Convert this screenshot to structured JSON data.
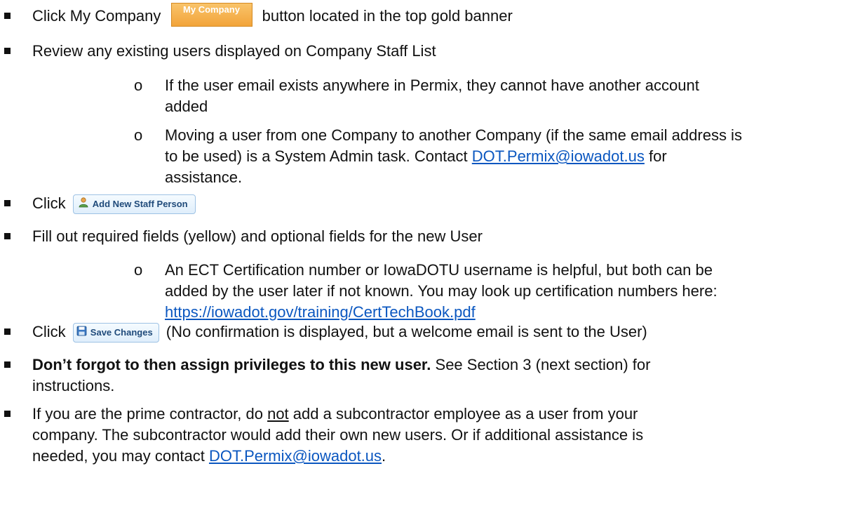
{
  "items": {
    "b1": {
      "pre": "Click My Company",
      "button": "My Company",
      "post": "button located in the top gold banner"
    },
    "b2": {
      "text": "Review any existing users displayed on Company Staff List"
    },
    "s1": {
      "line1": "If the user email exists anywhere in Permix, they cannot have another account",
      "line2": "added"
    },
    "s2": {
      "line1": "Moving a user from one Company to another Company (if the same email address is",
      "line2_pre": "to be used) is a System Admin task.  Contact",
      "link": "DOT.Permix@iowadot.us",
      "line2_post": "for",
      "line3": "assistance."
    },
    "b3": {
      "pre": "Click",
      "button": "Add New Staff Person"
    },
    "b4": {
      "text": "Fill out required fields (yellow) and optional fields for the new User"
    },
    "s3": {
      "line1": "An ECT Certification number or IowaDOTU username is helpful, but both can be",
      "line2": "added by the user later if not known.  You may look up certification numbers here:",
      "link": "https://iowadot.gov/training/CertTechBook.pdf"
    },
    "b5": {
      "pre": "Click",
      "button": "Save Changes",
      "post": "(No confirmation is displayed, but a welcome email is sent to the User)"
    },
    "b6": {
      "bold": "Don’t forgot to then assign privileges to this new user.",
      "rest": "See Section 3 (next section) for",
      "line2": "instructions."
    },
    "b7": {
      "pre": "If you are the prime contractor, do",
      "underlined": "not",
      "post": "add a subcontractor employee as a user from your",
      "line2": "company.  The subcontractor would add their own new users.  Or if additional assistance is",
      "line3_pre": "needed, you may contact",
      "link": "DOT.Permix@iowadot.us",
      "line3_post": "."
    }
  },
  "colors": {
    "link": "#0b57c0",
    "gold_button": "#f2a43a",
    "ui_button_text": "#1f4a7a"
  },
  "icons": {
    "bullet": "square-bullet",
    "sub_bullet": "hollow-circle",
    "add_staff": "person-icon",
    "save": "floppy-disk-icon"
  }
}
